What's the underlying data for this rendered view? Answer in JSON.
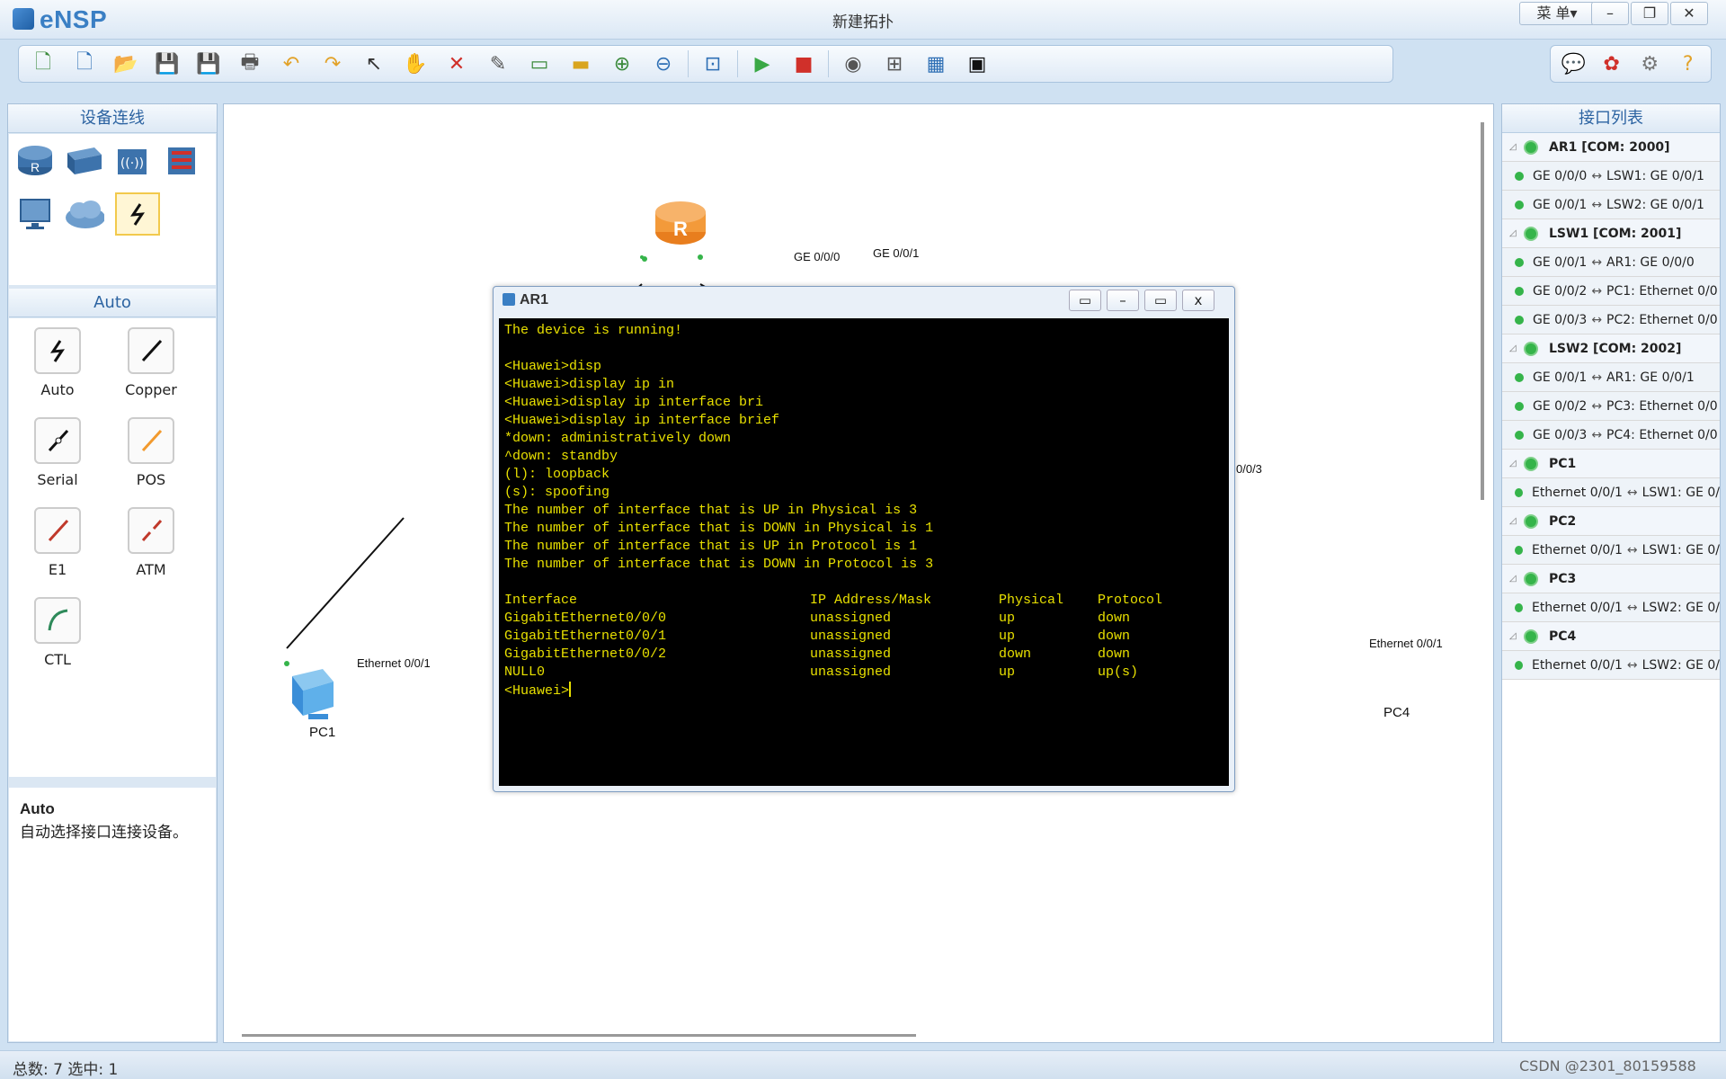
{
  "app": {
    "logo": "eNSP",
    "window_title": "新建拓扑",
    "menu_label": "菜 单▾",
    "minimize": "–",
    "restore": "❐",
    "close": "✕"
  },
  "toolbar": {
    "buttons": [
      {
        "name": "new-topology",
        "glyph": "🗋",
        "color": "#3b8a3b"
      },
      {
        "name": "new-example",
        "glyph": "🗋",
        "color": "#2e6fb5"
      },
      {
        "name": "open",
        "glyph": "📂",
        "color": "#e2a229"
      },
      {
        "name": "save",
        "glyph": "💾",
        "color": "#c0392b"
      },
      {
        "name": "save-as",
        "glyph": "💾",
        "color": "#2e6fb5"
      },
      {
        "name": "print",
        "glyph": "🖶",
        "color": "#555"
      },
      {
        "name": "undo",
        "glyph": "↶",
        "color": "#e2a229"
      },
      {
        "name": "redo",
        "glyph": "↷",
        "color": "#e2a229"
      },
      {
        "name": "select",
        "glyph": "↖",
        "color": "#333"
      },
      {
        "name": "pan",
        "glyph": "✋",
        "color": "#e2a229"
      },
      {
        "name": "delete",
        "glyph": "✕",
        "color": "#d0302a"
      },
      {
        "name": "delete-link",
        "glyph": "✎",
        "color": "#555"
      },
      {
        "name": "text",
        "glyph": "▭",
        "color": "#3b8a3b"
      },
      {
        "name": "rectangle",
        "glyph": "▬",
        "color": "#d9a51e"
      },
      {
        "name": "zoom-in",
        "glyph": "⊕",
        "color": "#3b8a3b"
      },
      {
        "name": "zoom-out",
        "glyph": "⊖",
        "color": "#2e6fb5"
      },
      {
        "name": "fit",
        "glyph": "⊡",
        "color": "#2e6fb5"
      },
      {
        "name": "start-all",
        "glyph": "▶",
        "color": "#39a845"
      },
      {
        "name": "stop-all",
        "glyph": "■",
        "color": "#d0302a"
      },
      {
        "name": "capture",
        "glyph": "◉",
        "color": "#555"
      },
      {
        "name": "topology",
        "glyph": "⊞",
        "color": "#555"
      },
      {
        "name": "grid",
        "glyph": "▦",
        "color": "#2e6fb5"
      },
      {
        "name": "screenshot",
        "glyph": "▣",
        "color": "#111"
      }
    ],
    "right_buttons": [
      {
        "name": "message",
        "glyph": "💬",
        "color": "#2e6fb5"
      },
      {
        "name": "huawei",
        "glyph": "✿",
        "color": "#d0302a"
      },
      {
        "name": "settings",
        "glyph": "⚙",
        "color": "#777"
      },
      {
        "name": "help",
        "glyph": "?",
        "color": "#e2a229"
      }
    ]
  },
  "left_panel": {
    "device_title": "设备连线",
    "auto_title": "Auto",
    "connections": [
      {
        "label": "Auto",
        "color": "#111"
      },
      {
        "label": "Copper",
        "color": "#111"
      },
      {
        "label": "Serial",
        "color": "#111"
      },
      {
        "label": "POS",
        "color": "#f29a2e"
      },
      {
        "label": "E1",
        "color": "#c0392b"
      },
      {
        "label": "ATM",
        "color": "#c0392b"
      },
      {
        "label": "CTL",
        "color": "#2e8a5a"
      }
    ],
    "help_title": "Auto",
    "help_text": "自动选择接口连接设备。"
  },
  "topology": {
    "nodes": [
      {
        "name": "AR1",
        "label": ""
      },
      {
        "name": "PC1",
        "label": "PC1"
      },
      {
        "name": "PC4",
        "label": "PC4"
      }
    ],
    "port_labels": [
      "GE 0/0/0",
      "GE 0/0/1",
      "Ethernet 0/0/1",
      "Ethernet 0/0/1",
      "0/0/3"
    ]
  },
  "terminal": {
    "title": "AR1",
    "lines": [
      "The device is running!",
      "",
      "<Huawei>disp",
      "<Huawei>display ip in",
      "<Huawei>display ip interface bri",
      "<Huawei>display ip interface brief",
      "*down: administratively down",
      "^down: standby",
      "(l): loopback",
      "(s): spoofing",
      "The number of interface that is UP in Physical is 3",
      "The number of interface that is DOWN in Physical is 1",
      "The number of interface that is UP in Protocol is 1",
      "The number of interface that is DOWN in Protocol is 3",
      ""
    ],
    "table_header": [
      "Interface",
      "IP Address/Mask",
      "Physical",
      "Protocol"
    ],
    "table_rows": [
      [
        "GigabitEthernet0/0/0",
        "unassigned",
        "up",
        "down"
      ],
      [
        "GigabitEthernet0/0/1",
        "unassigned",
        "up",
        "down"
      ],
      [
        "GigabitEthernet0/0/2",
        "unassigned",
        "down",
        "down"
      ],
      [
        "NULL0",
        "unassigned",
        "up",
        "up(s)"
      ]
    ],
    "prompt": "<Huawei>"
  },
  "interface_list": {
    "title": "接口列表",
    "rows": [
      {
        "type": "dev",
        "text": "AR1 [COM: 2000]"
      },
      {
        "type": "if",
        "left": "GE 0/0/0",
        "right": "LSW1: GE 0/0/1"
      },
      {
        "type": "if",
        "left": "GE 0/0/1",
        "right": "LSW2: GE 0/0/1"
      },
      {
        "type": "dev",
        "text": "LSW1 [COM: 2001]"
      },
      {
        "type": "if",
        "left": "GE 0/0/1",
        "right": "AR1: GE 0/0/0"
      },
      {
        "type": "if",
        "left": "GE 0/0/2",
        "right": "PC1: Ethernet 0/0"
      },
      {
        "type": "if",
        "left": "GE 0/0/3",
        "right": "PC2: Ethernet 0/0"
      },
      {
        "type": "dev",
        "text": "LSW2 [COM: 2002]"
      },
      {
        "type": "if",
        "left": "GE 0/0/1",
        "right": "AR1: GE 0/0/1"
      },
      {
        "type": "if",
        "left": "GE 0/0/2",
        "right": "PC3: Ethernet 0/0"
      },
      {
        "type": "if",
        "left": "GE 0/0/3",
        "right": "PC4: Ethernet 0/0"
      },
      {
        "type": "dev",
        "text": "PC1"
      },
      {
        "type": "if",
        "left": "Ethernet 0/0/1",
        "right": "LSW1: GE 0/"
      },
      {
        "type": "dev",
        "text": "PC2"
      },
      {
        "type": "if",
        "left": "Ethernet 0/0/1",
        "right": "LSW1: GE 0/"
      },
      {
        "type": "dev",
        "text": "PC3"
      },
      {
        "type": "if",
        "left": "Ethernet 0/0/1",
        "right": "LSW2: GE 0/"
      },
      {
        "type": "dev",
        "text": "PC4"
      },
      {
        "type": "if",
        "left": "Ethernet 0/0/1",
        "right": "LSW2: GE 0/"
      }
    ]
  },
  "status": {
    "text": "总数: 7 选中: 1",
    "watermark": "CSDN @2301_80159588"
  }
}
